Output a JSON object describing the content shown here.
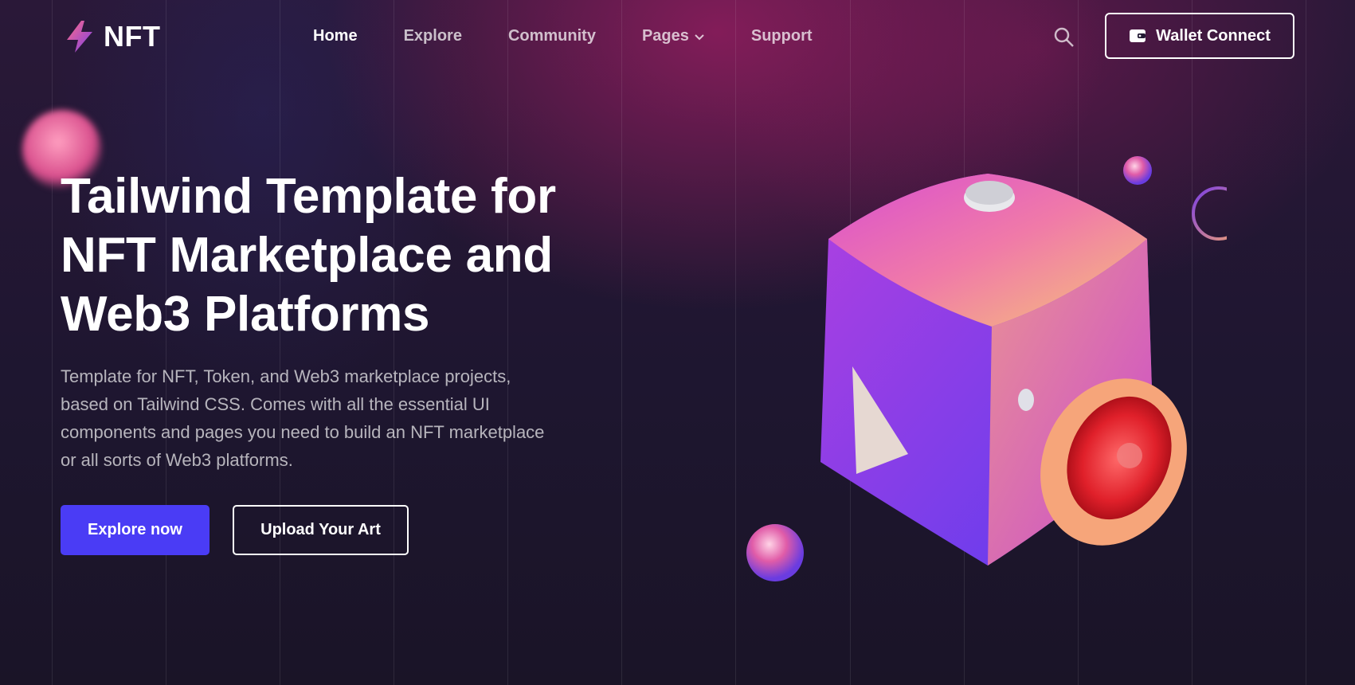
{
  "brand": {
    "name": "NFT",
    "accent": "#4a3cf5",
    "logo_gradient": [
      "#ff6a8a",
      "#7b3fe4"
    ]
  },
  "nav": {
    "items": [
      {
        "label": "Home",
        "active": true
      },
      {
        "label": "Explore",
        "active": false
      },
      {
        "label": "Community",
        "active": false
      },
      {
        "label": "Pages",
        "active": false,
        "has_dropdown": true
      },
      {
        "label": "Support",
        "active": false
      }
    ]
  },
  "header": {
    "search_icon": "search-icon",
    "wallet_label": "Wallet Connect",
    "wallet_icon": "wallet-icon"
  },
  "hero": {
    "title_lines": [
      "Tailwind Template for",
      "NFT Marketplace and",
      "Web3 Platforms"
    ],
    "description": "Template for NFT, Token, and Web3 marketplace projects, based on Tailwind CSS. Comes with all the essential UI components and pages you need to build an NFT marketplace or all sorts of Web3 platforms.",
    "primary_button": "Explore now",
    "secondary_button": "Upload Your Art"
  },
  "colors": {
    "background": "#1e1630",
    "magenta_glow": "#a01e64"
  }
}
